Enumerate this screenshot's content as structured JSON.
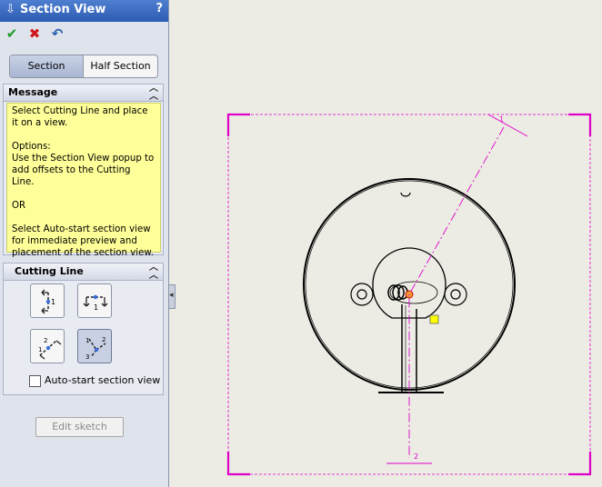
{
  "panel": {
    "title": "Section View",
    "help": "?",
    "actions": {
      "ok": "✔",
      "cancel": "✖",
      "undo": "↶"
    },
    "tabs": [
      "Section",
      "Half Section"
    ],
    "active_tab": "Section"
  },
  "message": {
    "header": "Message",
    "paragraphs": [
      "Select Cutting Line and place it on a view.",
      "Options:\nUse the Section View popup to add offsets to the Cutting Line.",
      "OR",
      "Select Auto-start section view for immediate preview and placement of the section view."
    ]
  },
  "cutting_line": {
    "header": "Cutting Line",
    "options": [
      "vertical",
      "horizontal",
      "auxiliary",
      "aligned"
    ],
    "selected": "aligned",
    "auto_start_label": "Auto-start section view",
    "auto_start_checked": false
  },
  "edit_sketch_label": "Edit sketch",
  "drawing": {
    "cutting_line_labels": [
      "1",
      "2"
    ]
  },
  "colors": {
    "accent": "#e000c8",
    "highlight": "#ffff00",
    "message_bg": "#ffff99",
    "title_bar": "#2c5bb2"
  }
}
